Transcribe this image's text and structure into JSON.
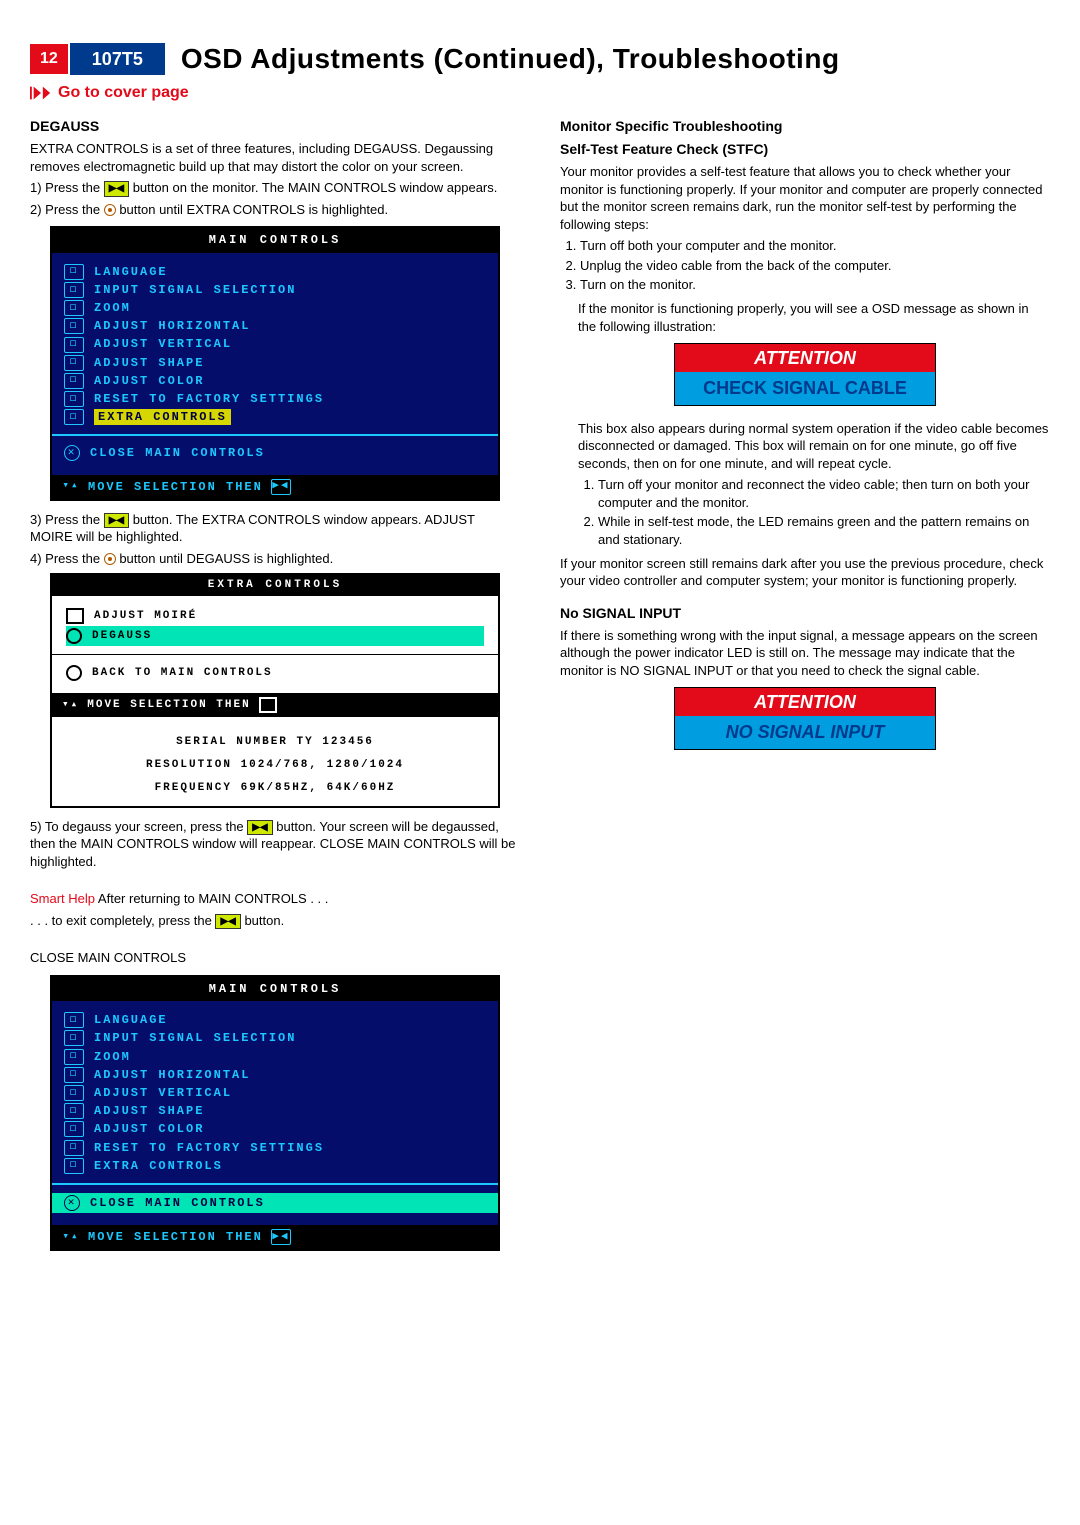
{
  "header": {
    "page": "12",
    "model": "107T5",
    "title": "OSD  Adjustments (Continued), Troubleshooting",
    "coverlink": "Go to cover page"
  },
  "left": {
    "degauss": {
      "heading": "DEGAUSS",
      "intro": "EXTRA CONTROLS is a set of three features, including DEGAUSS. Degaussing removes electromagnetic build up that may distort the color on your screen.",
      "step1a": "1) Press the ",
      "step1b": " button on the monitor. The MAIN CONTROLS window appears.",
      "step2a": "2) Press the ",
      "step2b": " button until EXTRA CONTROLS is highlighted.",
      "step3a": "3) Press the ",
      "step3b": " button. The EXTRA CONTROLS window appears.  ADJUST MOIRE  will be highlighted.",
      "step4a": "4) Press the ",
      "step4b": " button until DEGAUSS is highlighted.",
      "step5a": "5) To degauss your screen, press the ",
      "step5b": " button. Your screen will be degaussed, then the MAIN CONTROLS window will reappear. CLOSE MAIN CONTROLS will be highlighted.",
      "smarthelp_label": "Smart Help",
      "smarthelp_text": "   After returning to MAIN CONTROLS . . .",
      "exit_a": ". . . to exit completely, press the ",
      "exit_b": " button.",
      "closemain": "CLOSE MAIN CONTROLS"
    },
    "osd_main": {
      "title": "MAIN  CONTROLS",
      "items": [
        {
          "icon": "globe-icon",
          "label": "LANGUAGE"
        },
        {
          "icon": "input-icon",
          "label": "INPUT  SIGNAL  SELECTION"
        },
        {
          "icon": "zoom-icon",
          "label": "ZOOM"
        },
        {
          "icon": "horiz-icon",
          "label": "ADJUST  HORIZONTAL"
        },
        {
          "icon": "vert-icon",
          "label": "ADJUST  VERTICAL"
        },
        {
          "icon": "shape-icon",
          "label": "ADJUST  SHAPE"
        },
        {
          "icon": "color-icon",
          "label": "ADJUST  COLOR"
        },
        {
          "icon": "reset-icon",
          "label": "RESET  TO  FACTORY  SETTINGS"
        },
        {
          "icon": "extra-icon",
          "label": "EXTRA  CONTROLS",
          "hl": "yellow"
        }
      ],
      "close": {
        "icon": "close-icon",
        "label": "CLOSE  MAIN  CONTROLS"
      },
      "footer": "MOVE  SELECTION  THEN"
    },
    "osd_extra": {
      "title": "EXTRA  CONTROLS",
      "items": [
        {
          "icon": "moire-icon",
          "label": "ADJUST  MOIRÉ"
        },
        {
          "icon": "degauss-icon",
          "label": "DEGAUSS",
          "hl": "green"
        }
      ],
      "back": {
        "icon": "back-icon",
        "label": "BACK  TO  MAIN  CONTROLS"
      },
      "footer": "MOVE SELECTION THEN",
      "serial": "SERIAL  NUMBER TY  123456",
      "resolution": "RESOLUTION  1024/768, 1280/1024",
      "frequency": "FREQUENCY  69K/85HZ, 64K/60HZ"
    },
    "osd_main2": {
      "title": "MAIN  CONTROLS",
      "items": [
        {
          "icon": "globe-icon",
          "label": "LANGUAGE"
        },
        {
          "icon": "input-icon",
          "label": "INPUT  SIGNAL  SELECTION"
        },
        {
          "icon": "zoom-icon",
          "label": "ZOOM"
        },
        {
          "icon": "horiz-icon",
          "label": "ADJUST  HORIZONTAL"
        },
        {
          "icon": "vert-icon",
          "label": "ADJUST  VERTICAL"
        },
        {
          "icon": "shape-icon",
          "label": "ADJUST  SHAPE"
        },
        {
          "icon": "color-icon",
          "label": "ADJUST  COLOR"
        },
        {
          "icon": "reset-icon",
          "label": "RESET  TO  FACTORY  SETTINGS"
        },
        {
          "icon": "extra-icon",
          "label": "EXTRA  CONTROLS"
        }
      ],
      "close": {
        "icon": "close-icon",
        "label": "CLOSE  MAIN  CONTROLS",
        "hl": "cyan"
      },
      "footer": "MOVE  SELECTION  THEN"
    }
  },
  "right": {
    "mst_heading": "Monitor Specific Troubleshooting",
    "stfc_heading": "Self-Test Feature Check (STFC)",
    "stfc_intro": "Your monitor provides a self-test feature that allows you to check whether your monitor is functioning properly. If your monitor and computer are properly connected but the monitor screen remains dark, run the monitor self-test by performing the following steps:",
    "stfc_steps": [
      "Turn off both your computer and the monitor.",
      "Unplug the video cable from the back of the computer.",
      "Turn on the monitor."
    ],
    "stfc_after": "If the monitor is functioning properly, you will see a OSD message as shown in the following illustration:",
    "att1": {
      "top": "ATTENTION",
      "bottom": "CHECK SIGNAL CABLE"
    },
    "stfc_box_desc": "This box also appears during normal system operation if the video cable becomes disconnected or damaged. This box will remain on for one minute, go off five seconds, then on for one minute, and will repeat cycle.",
    "stfc_steps2": [
      "Turn off your monitor and reconnect the video cable; then turn on both your computer and the monitor.",
      "While in self-test mode, the LED remains green and the pattern remains on and stationary."
    ],
    "stfc_end": "If your monitor screen still remains dark after you use the previous procedure, check your video controller and computer system; your monitor is functioning properly.",
    "nosig_heading": "No SIGNAL INPUT",
    "nosig_text": "If there is something wrong with the input signal, a message appears on the screen although the power indicator LED is still on. The message may indicate that the monitor is NO SIGNAL INPUT or that you need to check the signal cable.",
    "att2": {
      "top": "ATTENTION",
      "bottom": "NO SIGNAL INPUT"
    }
  }
}
